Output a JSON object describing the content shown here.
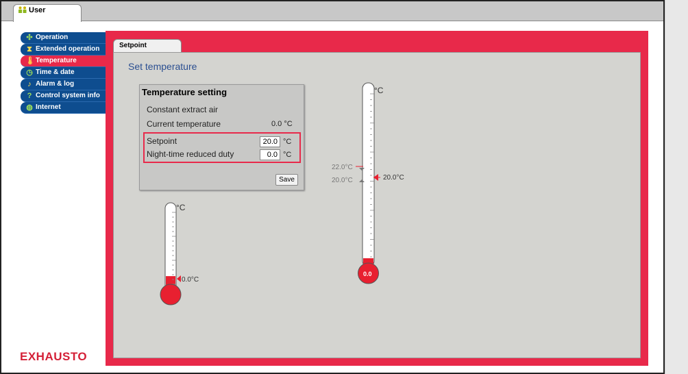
{
  "top_tab": {
    "label": "User",
    "icon": "users-icon"
  },
  "sidebar": {
    "items": [
      {
        "label": "Operation",
        "icon": "fan-icon",
        "active": false
      },
      {
        "label": "Extended operation",
        "icon": "hourglass-icon",
        "active": false
      },
      {
        "label": "Temperature",
        "icon": "thermometer-icon",
        "active": true
      },
      {
        "label": "Time & date",
        "icon": "clock-icon",
        "active": false
      },
      {
        "label": "Alarm & log",
        "icon": "bell-icon",
        "active": false
      },
      {
        "label": "Control system info",
        "icon": "question-icon",
        "active": false
      },
      {
        "label": "Internet",
        "icon": "globe-icon",
        "active": false
      }
    ]
  },
  "brand": {
    "logo_text": "EXHAUSTO",
    "accent": "#e8294a",
    "nav_blue": "#0e4d8f"
  },
  "sub_tab": {
    "label": "Setpoint"
  },
  "page": {
    "title": "Set temperature"
  },
  "temperature_setting": {
    "title": "Temperature setting",
    "mode": "Constant extract air",
    "current_label": "Current temperature",
    "current_value": "0.0",
    "current_unit": "°C",
    "setpoint_label": "Setpoint",
    "setpoint_value": "20.0",
    "setpoint_unit": "°C",
    "night_label": "Night-time reduced duty",
    "night_value": "0.0",
    "night_unit": "°C",
    "save_label": "Save"
  },
  "small_thermometer": {
    "unit": "°C",
    "reading_label": "0.0°C",
    "fill_fraction": 0.12
  },
  "large_thermometer": {
    "unit": "°C",
    "bulb_value": "0.0",
    "upper_limit_label": "22.0°C",
    "lower_limit_label": "20.0°C",
    "setpoint_label": "20.0°C",
    "fill_fraction": 0.03
  }
}
